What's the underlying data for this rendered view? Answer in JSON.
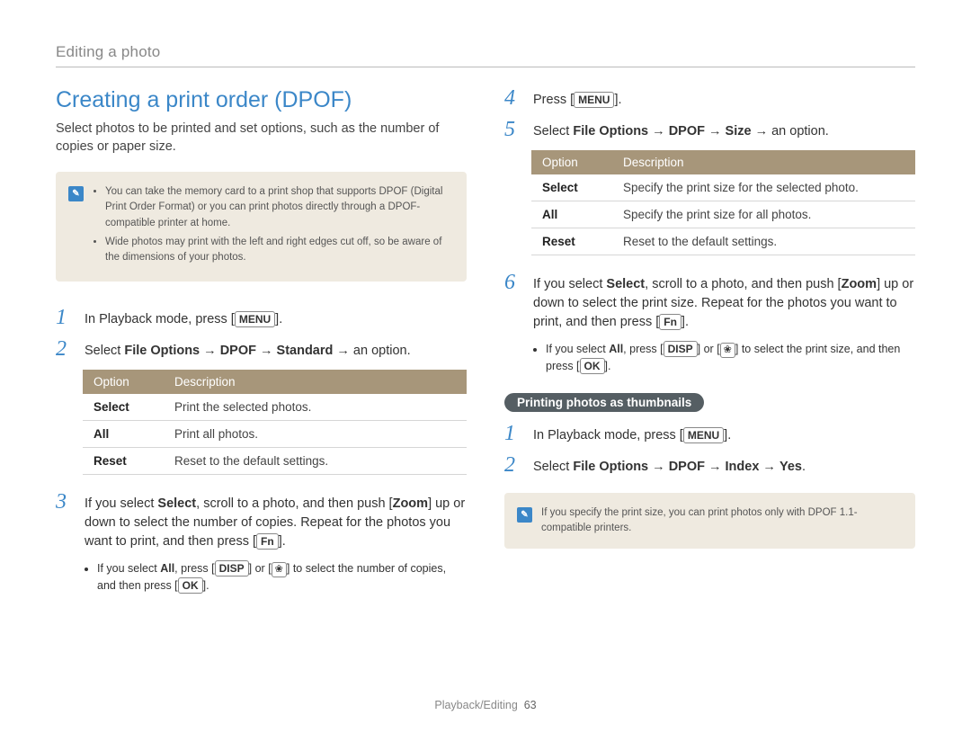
{
  "breadcrumb": "Editing a photo",
  "title": "Creating a print order (DPOF)",
  "subtitle": "Select photos to be printed and set options, such as the number of copies or paper size.",
  "noteA": {
    "item1": "You can take the memory card to a print shop that supports DPOF (Digital Print Order Format) or you can print photos directly through a DPOF-compatible printer at home.",
    "item2": "Wide photos may print with the left and right edges cut off, so be aware of the dimensions of your photos."
  },
  "left": {
    "step1_prefix": "In Playback mode, press [",
    "step1_key": "MENU",
    "step1_suffix": "].",
    "step2_prefix": "Select ",
    "step2_b1": "File Options",
    "step2_arrow": " → ",
    "step2_b2": "DPOF",
    "step2_b3": "Standard",
    "step2_suffix": " → an option.",
    "table": {
      "h1": "Option",
      "h2": "Description",
      "r1c1": "Select",
      "r1c2": "Print the selected photos.",
      "r2c1": "All",
      "r2c2": "Print all photos.",
      "r3c1": "Reset",
      "r3c2": "Reset to the default settings."
    },
    "step3_p1": "If you select ",
    "step3_b1": "Select",
    "step3_p2": ", scroll to a photo, and then push [",
    "step3_b2": "Zoom",
    "step3_p3": "] up or down to select the number of copies. Repeat for the photos you want to print, and then press [",
    "step3_key": "Fn",
    "step3_p4": "].",
    "side3_p1": "If you select ",
    "side3_b1": "All",
    "side3_p2": ", press [",
    "side3_k1": "DISP",
    "side3_p3": "] or [",
    "side3_p4": "] to select the number of copies, and then press [",
    "side3_k2": "OK",
    "side3_p5": "]."
  },
  "right": {
    "step4_prefix": "Press [",
    "step4_key": "MENU",
    "step4_suffix": "].",
    "step5_prefix": "Select ",
    "step5_b1": "File Options",
    "step5_arrow": " → ",
    "step5_b2": "DPOF",
    "step5_b3": "Size",
    "step5_suffix": " → an option.",
    "table": {
      "h1": "Option",
      "h2": "Description",
      "r1c1": "Select",
      "r1c2": "Specify the print size for the selected photo.",
      "r2c1": "All",
      "r2c2": "Specify the print size for all photos.",
      "r3c1": "Reset",
      "r3c2": "Reset to the default settings."
    },
    "step6_p1": "If you select ",
    "step6_b1": "Select",
    "step6_p2": ", scroll to a photo, and then push [",
    "step6_b2": "Zoom",
    "step6_p3": "] up or down to select the print size. Repeat for the photos you want to print, and then press [",
    "step6_key": "Fn",
    "step6_p4": "].",
    "side6_p1": "If you select ",
    "side6_b1": "All",
    "side6_p2": ", press [",
    "side6_k1": "DISP",
    "side6_p3": "] or [",
    "side6_p4": "] to select the print size, and then press [",
    "side6_k2": "OK",
    "side6_p5": "].",
    "pill": "Printing photos as thumbnails",
    "tstep1_prefix": "In Playback mode, press [",
    "tstep1_key": "MENU",
    "tstep1_suffix": "].",
    "tstep2_prefix": "Select ",
    "tstep2_b1": "File Options",
    "tstep2_arrow": " → ",
    "tstep2_b2": "DPOF",
    "tstep2_b3": "Index",
    "tstep2_b4": "Yes",
    "tstep2_suffix": "."
  },
  "noteB": {
    "text": "If you specify the print size, you can print photos only with DPOF 1.1-compatible printers."
  },
  "footer": {
    "section": "Playback/Editing",
    "page": "63"
  },
  "icons": {
    "note": "✎",
    "flower": "❀"
  }
}
